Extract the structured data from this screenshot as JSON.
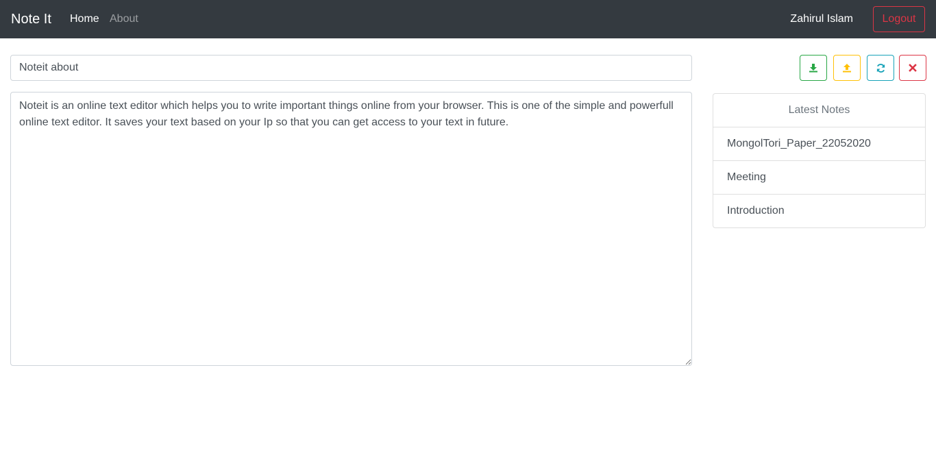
{
  "navbar": {
    "brand": "Note It",
    "links": [
      {
        "label": "Home",
        "active": true
      },
      {
        "label": "About",
        "active": false
      }
    ],
    "username": "Zahirul Islam",
    "logout_label": "Logout",
    "background": "#343a40"
  },
  "editor": {
    "title_value": "Noteit about",
    "content_value": "Noteit is an online text editor which helps you to write important things online from your browser. This is one of the simple and powerfull online text editor. It saves your text based on your Ip so that you can get access to your text in future."
  },
  "toolbar": {
    "buttons": [
      {
        "icon": "download-icon",
        "color": "#28a745"
      },
      {
        "icon": "upload-icon",
        "color": "#ffc107"
      },
      {
        "icon": "refresh-icon",
        "color": "#17a2b8"
      },
      {
        "icon": "close-icon",
        "color": "#dc3545"
      }
    ]
  },
  "notes": {
    "header": "Latest Notes",
    "items": [
      "MongolTori_Paper_22052020",
      "Meeting",
      "Introduction"
    ]
  }
}
